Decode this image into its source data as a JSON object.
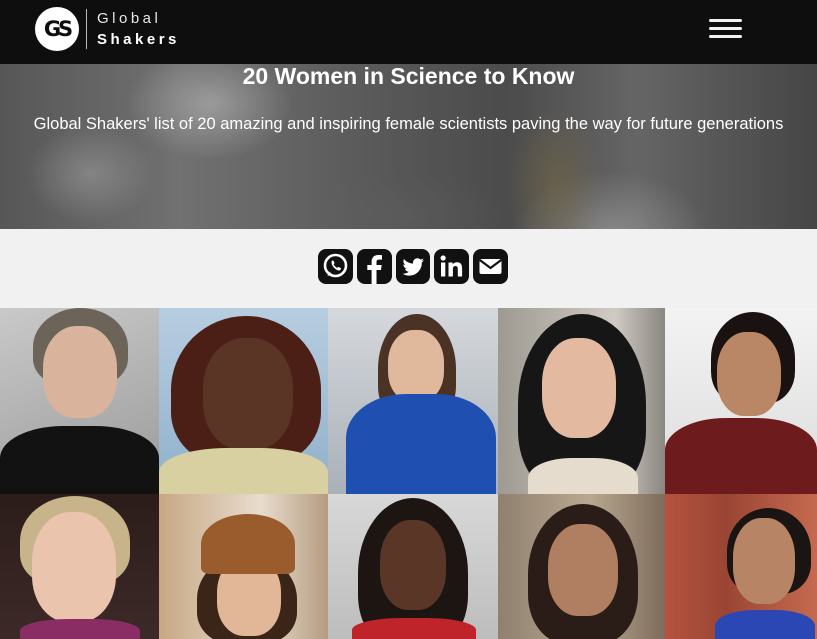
{
  "header": {
    "logo_mark": "GS",
    "brand_line1": "Global",
    "brand_line2": "Shakers",
    "menu_icon": "hamburger-menu-icon"
  },
  "hero": {
    "title": "20 Women in Science to Know",
    "subtitle": "Global Shakers' list of 20 amazing and inspiring female scientists paving the way for future generations"
  },
  "share": {
    "icons": [
      "whatsapp-icon",
      "facebook-icon",
      "twitter-icon",
      "linkedin-icon",
      "email-icon"
    ]
  },
  "grid": {
    "rows": 2,
    "columns": 5,
    "count": 10
  },
  "colors": {
    "header_bg": "#0e0e0e",
    "share_bg": "#f1f1f1",
    "icon": "#111111"
  }
}
